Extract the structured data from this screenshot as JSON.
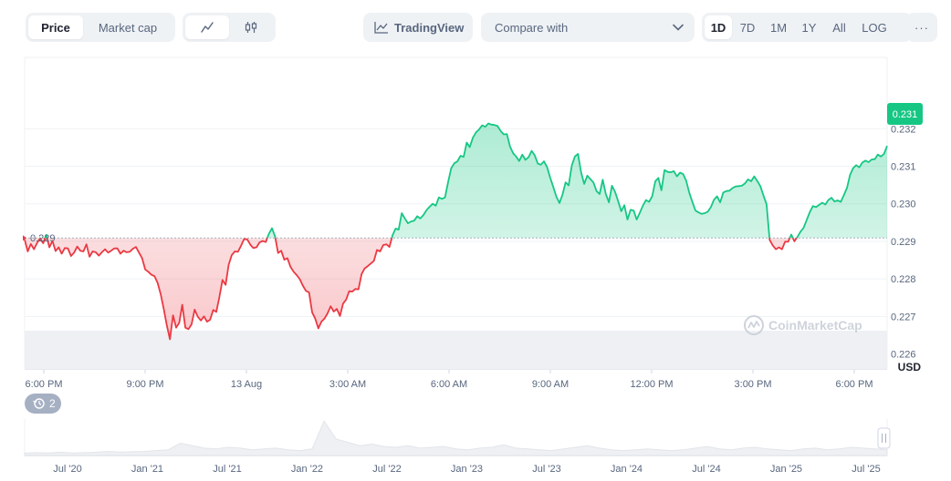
{
  "toolbar": {
    "metric_tabs": [
      "Price",
      "Market cap"
    ],
    "active_metric": "Price",
    "tradingview_label": "TradingView",
    "compare_label": "Compare with",
    "ranges": [
      "1D",
      "7D",
      "1M",
      "1Y",
      "All",
      "LOG"
    ],
    "active_range": "1D",
    "more_label": "···"
  },
  "chart": {
    "currency_label": "USD",
    "watermark": "CoinMarketCap",
    "current_price_label": "0.231",
    "baseline_label": "0.229",
    "events_count": "2",
    "colors": {
      "up": "#16c784",
      "down": "#ea3943"
    }
  },
  "chart_data": {
    "type": "line",
    "baseline": 0.22909,
    "ylim": [
      0.2256,
      0.2339
    ],
    "yticks": [
      {
        "v": 0.232,
        "label": "0.232"
      },
      {
        "v": 0.231,
        "label": "0.231"
      },
      {
        "v": 0.23,
        "label": "0.230"
      },
      {
        "v": 0.229,
        "label": "0.229"
      },
      {
        "v": 0.228,
        "label": "0.228"
      },
      {
        "v": 0.227,
        "label": "0.227"
      },
      {
        "v": 0.226,
        "label": "0.226"
      }
    ],
    "xticks": [
      "6:00 PM",
      "9:00 PM",
      "13 Aug",
      "3:00 AM",
      "6:00 AM",
      "9:00 AM",
      "12:00 PM",
      "3:00 PM",
      "6:00 PM"
    ],
    "series": [
      {
        "values": [
          0.22905,
          0.22873,
          0.22893,
          0.22879,
          0.22895,
          0.22908,
          0.22895,
          0.22917,
          0.22884,
          0.22901,
          0.22874,
          0.22884,
          0.22867,
          0.22882,
          0.22881,
          0.22861,
          0.2287,
          0.22886,
          0.22875,
          0.22873,
          0.22892,
          0.22859,
          0.22873,
          0.22871,
          0.22862,
          0.22871,
          0.22879,
          0.2287,
          0.22875,
          0.22881,
          0.22881,
          0.22867,
          0.22875,
          0.22871,
          0.22872,
          0.2288,
          0.22885,
          0.2287,
          0.22855,
          0.22825,
          0.22819,
          0.22811,
          0.22807,
          0.2279,
          0.2276,
          0.2272,
          0.22676,
          0.22639,
          0.22703,
          0.2267,
          0.22683,
          0.22731,
          0.2267,
          0.22666,
          0.22679,
          0.22718,
          0.22699,
          0.22689,
          0.227,
          0.22686,
          0.22691,
          0.22717,
          0.22712,
          0.22752,
          0.22797,
          0.22784,
          0.22837,
          0.22863,
          0.22873,
          0.22872,
          0.22888,
          0.22906,
          0.22905,
          0.22891,
          0.22882,
          0.22884,
          0.22897,
          0.22901,
          0.22898,
          0.2292,
          0.22935,
          0.22913,
          0.22869,
          0.22875,
          0.22851,
          0.22855,
          0.22832,
          0.22819,
          0.2281,
          0.22799,
          0.22782,
          0.22768,
          0.22764,
          0.22711,
          0.22694,
          0.22668,
          0.22686,
          0.22694,
          0.22708,
          0.22727,
          0.22713,
          0.2272,
          0.22701,
          0.22734,
          0.22745,
          0.22767,
          0.22766,
          0.22773,
          0.22772,
          0.22813,
          0.22828,
          0.22834,
          0.22841,
          0.22848,
          0.22877,
          0.22873,
          0.2289,
          0.22892,
          0.22885,
          0.22916,
          0.22934,
          0.22931,
          0.22975,
          0.22961,
          0.22948,
          0.22953,
          0.22955,
          0.22967,
          0.22961,
          0.2297,
          0.22983,
          0.22992,
          0.23,
          0.22995,
          0.23017,
          0.23013,
          0.23017,
          0.23058,
          0.23095,
          0.23108,
          0.23113,
          0.23128,
          0.23125,
          0.23163,
          0.23151,
          0.23176,
          0.2319,
          0.23198,
          0.23209,
          0.23205,
          0.23214,
          0.23211,
          0.2321,
          0.23207,
          0.23194,
          0.23185,
          0.23186,
          0.23153,
          0.23135,
          0.23126,
          0.23114,
          0.23131,
          0.23117,
          0.23124,
          0.23141,
          0.23129,
          0.23107,
          0.23104,
          0.23113,
          0.23098,
          0.2307,
          0.23045,
          0.23019,
          0.23002,
          0.23025,
          0.23057,
          0.23049,
          0.23102,
          0.23126,
          0.23133,
          0.23084,
          0.23053,
          0.23075,
          0.23066,
          0.23057,
          0.23034,
          0.23026,
          0.23064,
          0.23026,
          0.23004,
          0.23048,
          0.23032,
          0.23007,
          0.2298,
          0.22996,
          0.22958,
          0.22984,
          0.22982,
          0.22958,
          0.22976,
          0.22995,
          0.2301,
          0.23005,
          0.2302,
          0.2306,
          0.23069,
          0.23036,
          0.2309,
          0.23085,
          0.23084,
          0.23087,
          0.23073,
          0.23083,
          0.23079,
          0.23062,
          0.2303,
          0.23005,
          0.22982,
          0.22977,
          0.22973,
          0.22975,
          0.22979,
          0.22991,
          0.23011,
          0.2302,
          0.23004,
          0.2303,
          0.23034,
          0.23035,
          0.23042,
          0.23046,
          0.23047,
          0.23048,
          0.23054,
          0.23065,
          0.2306,
          0.23073,
          0.23061,
          0.23047,
          0.23022,
          0.22999,
          0.22904,
          0.22889,
          0.22879,
          0.22884,
          0.22879,
          0.22899,
          0.22899,
          0.22918,
          0.229,
          0.22912,
          0.22926,
          0.22936,
          0.22957,
          0.22978,
          0.22994,
          0.22991,
          0.22997,
          0.23003,
          0.22998,
          0.2301,
          0.23016,
          0.23006,
          0.23009,
          0.23005,
          0.23023,
          0.23042,
          0.23077,
          0.23095,
          0.23103,
          0.23097,
          0.2311,
          0.23115,
          0.23111,
          0.23118,
          0.23119,
          0.23131,
          0.23126,
          0.23133,
          0.23154
        ]
      }
    ],
    "volume": {
      "color": "#eef0f3"
    },
    "overview": {
      "xticks": [
        "Jul '20",
        "Jan '21",
        "Jul '21",
        "Jan '22",
        "Jul '22",
        "Jan '23",
        "Jul '23",
        "Jan '24",
        "Jul '24",
        "Jan '25",
        "Jul '25"
      ]
    }
  }
}
